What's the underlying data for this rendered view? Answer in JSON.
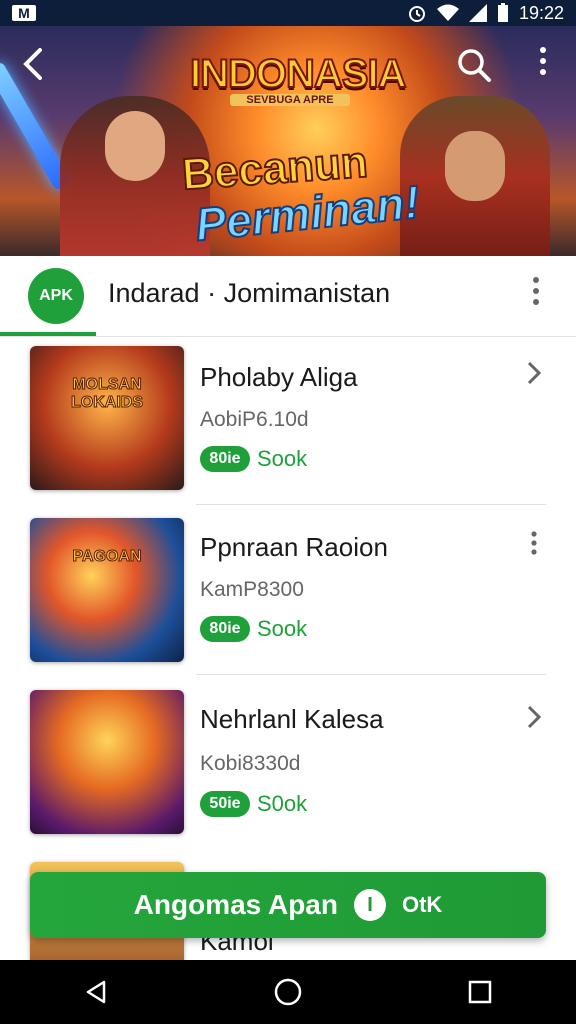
{
  "status_bar": {
    "time": "19:22",
    "mail_icon": "M"
  },
  "banner": {
    "title": "INDONASIA",
    "subtitle": "SEVBUGA APRE",
    "headline_1": "Becanun",
    "headline_2": "Perminan!"
  },
  "app_header": {
    "logo": "APK",
    "name": "Indarad · Jomimanistan"
  },
  "items": [
    {
      "title": "Pholaby Aliga",
      "sub": "AobiP6.10d",
      "badge": "80ie",
      "size": "Sook",
      "thumb_text": "MOLSAN LOKAIDS"
    },
    {
      "title": "Ppnraan Raoion",
      "sub": "KamP8300",
      "badge": "80ie",
      "size": "Sook",
      "thumb_text": "PAGOAN"
    },
    {
      "title": "Nehrlanl Kalesa",
      "sub": "Kobi8330d",
      "badge": "50ie",
      "size": "S0ok",
      "thumb_text": ""
    },
    {
      "title": "Kamol",
      "sub": "",
      "badge": "",
      "size": "",
      "thumb_text": ""
    }
  ],
  "cta": {
    "label": "Angomas Apan",
    "icon": "I",
    "sub": "OtK"
  },
  "colors": {
    "accent": "#1fa03a",
    "status_bar": "#0d1e3a"
  }
}
